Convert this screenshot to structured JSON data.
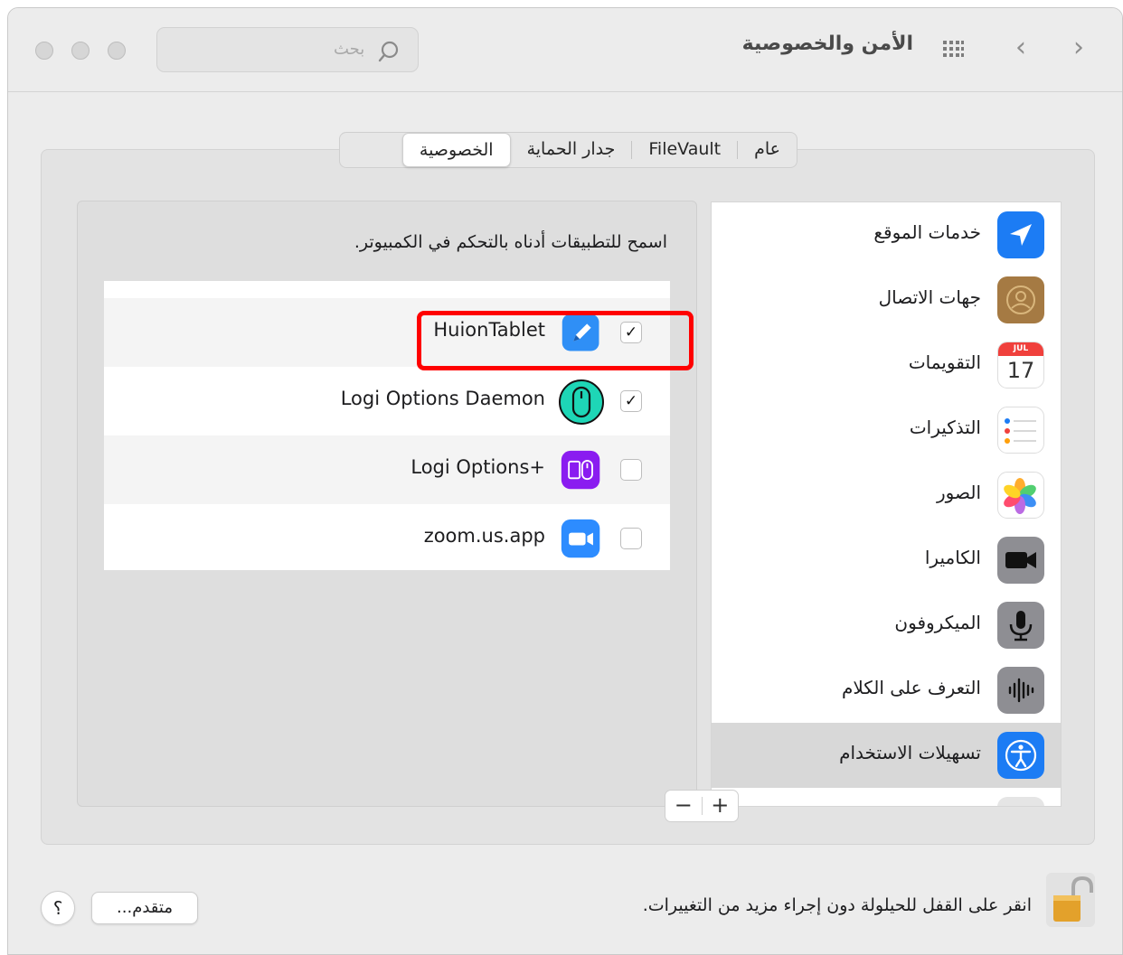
{
  "window": {
    "title": "الأمن والخصوصية",
    "nav_back": "‹",
    "nav_forward": "›"
  },
  "search": {
    "placeholder": "بحث"
  },
  "tabs": [
    {
      "label": "عام"
    },
    {
      "label": "FileVault"
    },
    {
      "label": "جدار الحماية"
    },
    {
      "label": "الخصوصية"
    }
  ],
  "active_tab": "الخصوصية",
  "sidebar": {
    "items": [
      {
        "label": "خدمات الموقع",
        "icon": "location-arrow-icon"
      },
      {
        "label": "جهات الاتصال",
        "icon": "contacts-icon"
      },
      {
        "label": "التقويمات",
        "icon": "calendar-icon",
        "cal_month": "JUL",
        "cal_day": "17"
      },
      {
        "label": "التذكيرات",
        "icon": "reminders-icon"
      },
      {
        "label": "الصور",
        "icon": "photos-icon"
      },
      {
        "label": "الكاميرا",
        "icon": "camera-icon"
      },
      {
        "label": "الميكروفون",
        "icon": "microphone-icon"
      },
      {
        "label": "التعرف على الكلام",
        "icon": "speech-waveform-icon"
      },
      {
        "label": "تسهيلات الاستخدام",
        "icon": "accessibility-icon",
        "selected": true
      }
    ]
  },
  "main": {
    "description": "اسمح للتطبيقات أدناه بالتحكم في الكمبيوتر.",
    "apps": [
      {
        "name": "HuionTablet",
        "checked": true,
        "mark": "✓",
        "icon": "huion-pen-icon"
      },
      {
        "name": "Logi Options Daemon",
        "checked": true,
        "mark": "✓",
        "icon": "logi-mouse-icon"
      },
      {
        "name": "Logi Options+",
        "checked": false,
        "mark": "",
        "icon": "logi-options-plus-icon"
      },
      {
        "name": "zoom.us.app",
        "checked": false,
        "mark": "",
        "icon": "zoom-camera-icon"
      }
    ],
    "add_label": "+",
    "remove_label": "−"
  },
  "footer": {
    "lock_text": "انقر على القفل للحيلولة دون إجراء مزيد من التغييرات.",
    "advanced_label": "متقدم...",
    "help_label": "؟"
  },
  "colors": {
    "highlight": "#ff0000",
    "accent": "#1c7cf4",
    "selected_row": "#d8d8d8"
  }
}
